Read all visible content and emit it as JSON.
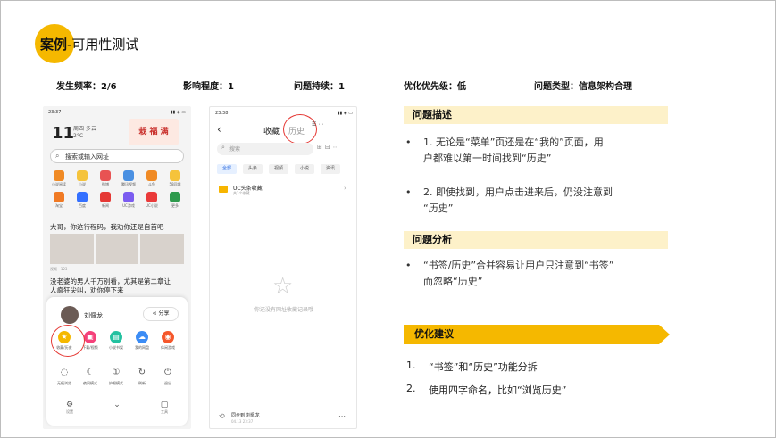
{
  "title": {
    "bold": "案例",
    "rest": "-可用性测试"
  },
  "metrics": {
    "frequency": "发生频率：2/6",
    "impact": "影响程度：1",
    "persistence": "问题持续：1",
    "priority": "优化优先级：低",
    "type": "问题类型：信息架构合理"
  },
  "phone1": {
    "time": "23:37",
    "status_icons": "▮▮ ◈ ▭",
    "date_num": "11",
    "date_line1": "周四 多云",
    "date_line2": "2°C",
    "banner": "栽 福 满",
    "search_placeholder": "搜索或输入网址",
    "apps": [
      {
        "label": "小说阅读",
        "color": "#f08a24"
      },
      {
        "label": "小说",
        "color": "#f5c33b"
      },
      {
        "label": "微博",
        "color": "#e85353"
      },
      {
        "label": "腾讯视频",
        "color": "#4a90e2"
      },
      {
        "label": "斗鱼",
        "color": "#f08a24"
      },
      {
        "label": "58同城",
        "color": "#f5c33b"
      },
      {
        "label": "淘宝",
        "color": "#f07a24"
      },
      {
        "label": "百度",
        "color": "#3470ff"
      },
      {
        "label": "新闻",
        "color": "#e53935"
      },
      {
        "label": "UC游戏",
        "color": "#7b5cf0"
      },
      {
        "label": "UC小说",
        "color": "#ea3a3a"
      },
      {
        "label": "更多",
        "color": "#2e9a4d"
      }
    ],
    "news1": "大哥，你这行程码，我劝你还是自首吧",
    "news1_meta": "视频 · 123",
    "news2_line1": "没老婆的男人千万别看，尤其是第二章让",
    "news2_line2": "人疯狂尖叫，劝你停下来",
    "sheet": {
      "user_name": "刘佩龙",
      "share_label": "分享",
      "row1": [
        {
          "label": "收藏/历史",
          "glyph": "★",
          "color": "#f5b800"
        },
        {
          "label": "下载/视频",
          "glyph": "▣",
          "color": "#f5417a"
        },
        {
          "label": "小说书架",
          "glyph": "▤",
          "color": "#23c1a0"
        },
        {
          "label": "我的网盘",
          "glyph": "☁",
          "color": "#3b8cf5"
        },
        {
          "label": "休闲游戏",
          "glyph": "◉",
          "color": "#f5572b"
        }
      ],
      "row2": [
        {
          "label": "无痕浏览",
          "glyph": "◌"
        },
        {
          "label": "夜间模式",
          "glyph": "☾"
        },
        {
          "label": "护眼模式",
          "glyph": "①"
        },
        {
          "label": "刷新",
          "glyph": "↻"
        },
        {
          "label": "退出",
          "glyph": "⏻"
        }
      ],
      "bottom": [
        {
          "label": "设置",
          "glyph": "⚙"
        },
        {
          "label": "",
          "glyph": "⌄"
        },
        {
          "label": "工具",
          "glyph": "▢"
        }
      ]
    }
  },
  "phone2": {
    "time": "23:38",
    "status_icons": "▮▮ ◈ ▭",
    "back": "‹",
    "tab_favorites": "收藏",
    "tab_history": "历史",
    "header_icons": "☰ ⋯",
    "search_placeholder": "搜索",
    "tools": "⊞⊟⋯",
    "chips": [
      {
        "label": "全部",
        "active": true
      },
      {
        "label": "头条",
        "active": false
      },
      {
        "label": "视频",
        "active": false
      },
      {
        "label": "小说",
        "active": false
      },
      {
        "label": "资讯",
        "active": false
      }
    ],
    "folder_title": "UC头条收藏",
    "folder_sub": "共1个收藏",
    "empty_text": "你还没有网址收藏记录哦",
    "sync_title": "同步到 刘佩龙",
    "sync_time": "04.13 23:37",
    "sync_more": "⋯"
  },
  "problem": {
    "heading": "问题描述",
    "items": [
      {
        "num": "1. ",
        "lines": [
          "无论是“菜单”页还是在“我的”页面，用",
          "户都难以第一时间找到“历史”"
        ]
      },
      {
        "num": "2. ",
        "lines": [
          "即使找到，用户点击进来后，仍没注意到",
          "“历史”"
        ]
      }
    ]
  },
  "analysis": {
    "heading": "问题分析",
    "lines": [
      "“书签/历史”合并容易让用户只注意到“书签”",
      "而忽略“历史”"
    ]
  },
  "suggestions": {
    "heading": "优化建议",
    "items": [
      {
        "num": "1.",
        "text": "“书签”和“历史”功能分拆"
      },
      {
        "num": "2.",
        "text": "使用四字命名，比如“浏览历史”"
      }
    ]
  },
  "colors": {
    "accent": "#f5b800",
    "section_bg": "#fdf1c9",
    "highlight_ring": "#e53935"
  }
}
